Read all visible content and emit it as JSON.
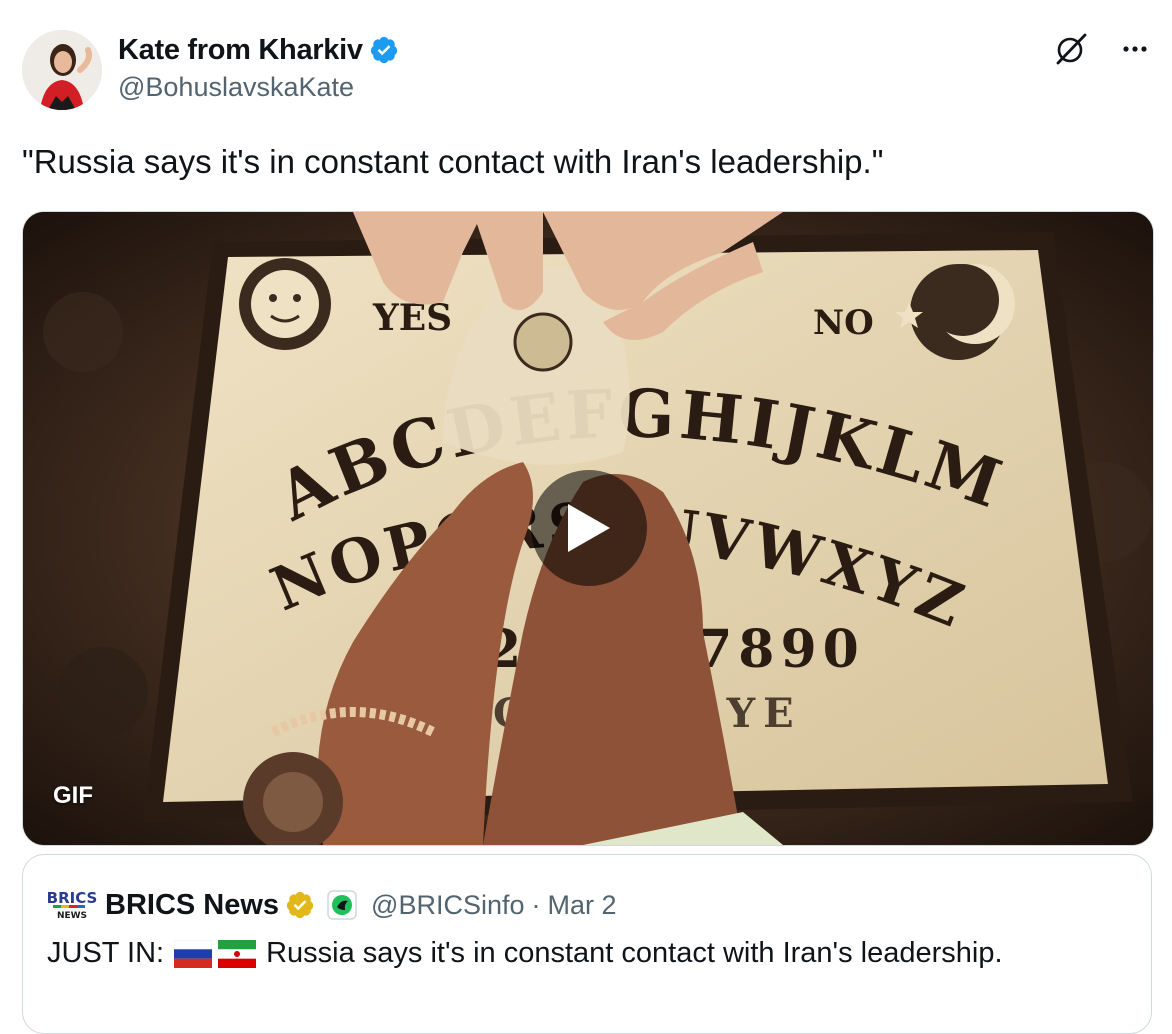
{
  "author": {
    "display_name": "Kate from Kharkiv",
    "handle": "@BohuslavskaKate",
    "verified_color": "#1d9bf0"
  },
  "actions": {
    "grok_icon": "grok-icon",
    "more_icon": "more-icon"
  },
  "tweet": {
    "text": "\"Russia says it's in constant contact with Iran's leadership.\""
  },
  "media": {
    "badge": "GIF",
    "board_texts": {
      "yes": "YES",
      "no": "NO",
      "row1": "ABCDEFGHIJKLM",
      "row2": "NOPQRSTUVWXYZ",
      "numbers": "1234567890",
      "goodbye": "GOOD BYE"
    }
  },
  "quote": {
    "display_name": "BRICS News",
    "logo_text_top": "BRICS",
    "logo_text_bottom": "NEWS",
    "handle": "@BRICSinfo",
    "separator": "·",
    "date": "Mar 2",
    "prefix": "JUST IN:",
    "text": "Russia says it's in constant contact with Iran's leadership.",
    "verified_color": "#e2b719"
  }
}
